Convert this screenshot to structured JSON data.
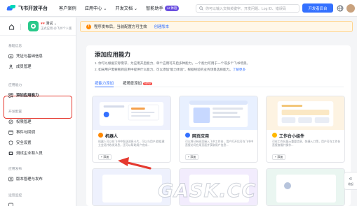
{
  "topbar": {
    "logo_text": "飞书开放平台",
    "nav": [
      "客户案例",
      "应用中心",
      "开发文档",
      "智能助手"
    ],
    "beta_badge": "AI 体验",
    "search_placeholder": "你可以输入文档关键字、开发问题、Log ID、错误码",
    "console_button": "开发者后台"
  },
  "sidebar": {
    "app_name": "测试",
    "app_hearts": "♥♥",
    "app_sub": "正式应用 @飞书个人版",
    "sections": [
      {
        "label": "基础信息",
        "items": [
          "凭证与基础信息",
          "成员管理"
        ]
      },
      {
        "label": "应用能力",
        "items": [
          "添加应用能力"
        ]
      },
      {
        "label": "开发配置",
        "items": [
          "权限管理",
          "事件与回调",
          "安全设置",
          "测试企业和人员"
        ]
      },
      {
        "label": "应用发布",
        "items": [
          "版本管理与发布"
        ]
      },
      {
        "label": "运营监控",
        "items": []
      }
    ]
  },
  "notice": {
    "text": "程序发布后，当前配置方可生效",
    "link": "创建版本"
  },
  "panel": {
    "title": "添加应用能力",
    "desc1": "1. 你可以根据实际需求，为应用开启能力，单个应用可开启多种能力，一个能力可用于一个或多个飞书场景。",
    "desc2": "2. 如采用户需要看到应用中提供什么能力，可以添加\"能力体验",
    "desc2_rest": "\"，根据经验的业务场景选择能力。",
    "desc2_link": "了解更多",
    "tabs": [
      "按能力添加",
      "按场景添加"
    ],
    "new_badge": "NEW"
  },
  "cards": [
    {
      "title": "机器人",
      "desc": "机器人可以在飞书中发送消息卡片，可以与用户/群组建立会话并收发消息，还可以帮助用户完成...",
      "button": "+ 添加",
      "color": "#ff8800"
    },
    {
      "title": "网页应用",
      "desc": "可以将已有网页接入飞书工作台，用户打开后可在飞书中直接访问应用页面并获取用户信息...",
      "button": "+ 添加",
      "color": "#3370ff"
    },
    {
      "title": "工作台小组件",
      "desc": "可在工作台展示重要信息、快捷入口等，用户可在工作台直接查看并操作...",
      "button": "+ 添加",
      "color": "#ffb800"
    }
  ],
  "collapse": {
    "label": "收起"
  },
  "watermark": "GASK.CC"
}
